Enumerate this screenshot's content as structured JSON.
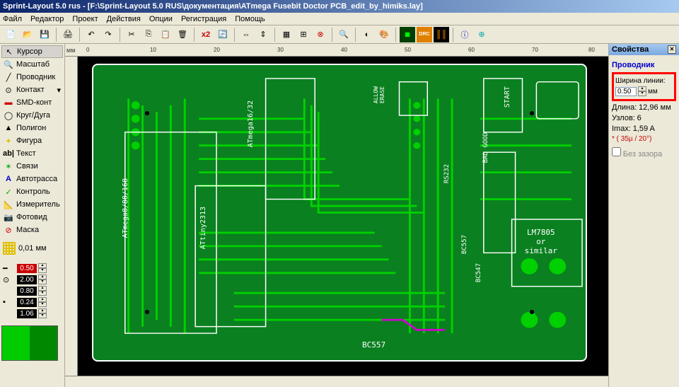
{
  "title": "Sprint-Layout 5.0 rus    - [F:\\Sprint-Layout 5.0 RUS\\документация\\ATmega Fusebit Doctor PCB_edit_by_himiks.lay]",
  "menu": [
    "Файл",
    "Редактор",
    "Проект",
    "Действия",
    "Опции",
    "Регистрация",
    "Помощь"
  ],
  "icons": {
    "new": "📄",
    "open": "📂",
    "save": "💾",
    "print": "🖨",
    "cut": "✂",
    "copy": "📋",
    "paste": "📋",
    "delete": "🗑",
    "undo": "↶",
    "redo": "↷",
    "rotate": "🔄",
    "mirrorh": "⇔",
    "mirrorv": "⇕",
    "zoom": "🔍",
    "scan": "📡",
    "x2": "x2",
    "drc": "DRC"
  },
  "tools": [
    {
      "icon": "↖",
      "label": "Курсор",
      "sel": true
    },
    {
      "icon": "🔍",
      "label": "Масштаб"
    },
    {
      "icon": "╱",
      "label": "Проводник"
    },
    {
      "icon": "⊙",
      "label": "Контакт"
    },
    {
      "icon": "▬",
      "label": "SMD-конт"
    },
    {
      "icon": "◯",
      "label": "Круг/Дуга"
    },
    {
      "icon": "▲",
      "label": "Полигон"
    },
    {
      "icon": "✦",
      "label": "Фигура"
    },
    {
      "icon": "ab|",
      "label": "Текст"
    },
    {
      "icon": "✶",
      "label": "Связи"
    },
    {
      "icon": "A",
      "label": "Автотрасса",
      "color": "#00c"
    },
    {
      "icon": "✓",
      "label": "Контроль"
    },
    {
      "icon": "📏",
      "label": "Измеритель"
    },
    {
      "icon": "📷",
      "label": "Фотовид"
    },
    {
      "icon": "⊘",
      "label": "Маска",
      "color": "#c00"
    }
  ],
  "grid": {
    "label": "0,01 мм"
  },
  "dims": [
    {
      "val": "0.50",
      "red": true,
      "icon": "━"
    },
    {
      "val": "2.00",
      "icon": "⊙"
    },
    {
      "val": "0.80",
      "icon": ""
    },
    {
      "val": "0.24",
      "icon": "▪"
    },
    {
      "val": "1.06",
      "icon": ""
    }
  ],
  "ruler_unit": "мм",
  "ruler_marks": [
    "0",
    "10",
    "20",
    "30",
    "40",
    "50",
    "60",
    "70",
    "80"
  ],
  "silk": {
    "chip1": "ATmega8/88/168",
    "chip2": "ATtiny2313",
    "chip3": "ATmega16/32",
    "allow": "ALLOW\nERASE",
    "start": "START",
    "badgood": "BAD  GOOD",
    "rs232": "RS232",
    "bc557a": "BC557",
    "bc547": "BC547",
    "reg": "LM7805\nor\nsimilar",
    "bc557b": "BC557"
  },
  "props": {
    "title": "Свойства",
    "subtitle": "Проводник",
    "width_label": "Ширина линии:",
    "width_val": "0.50",
    "width_unit": "мм",
    "rows": [
      {
        "label": "Длина:",
        "val": "12,96 мм"
      },
      {
        "label": "Узлов:",
        "val": "6"
      },
      {
        "label": "Imax:",
        "val": "1,59 A"
      }
    ],
    "note": "* ( 35µ / 20°)",
    "checkbox": "Без зазора"
  }
}
